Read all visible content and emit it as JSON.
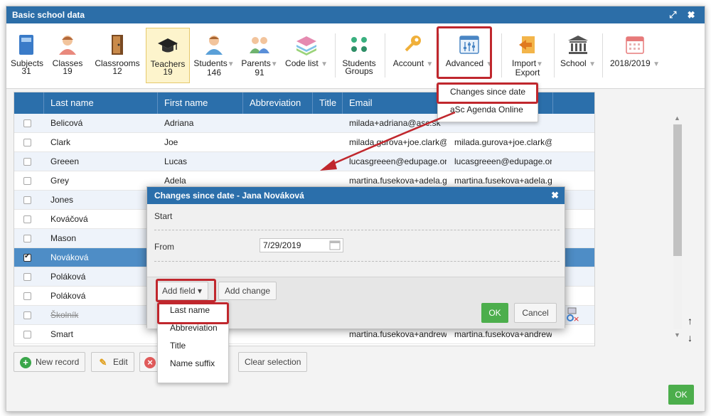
{
  "window": {
    "title": "Basic school data",
    "controls": "⤢ ✖"
  },
  "toolbar": {
    "subjects": {
      "label": "Subjects",
      "count": "31"
    },
    "classes": {
      "label": "Classes",
      "count": "19"
    },
    "classrooms": {
      "label": "Classrooms",
      "count": "12"
    },
    "teachers": {
      "label": "Teachers",
      "count": "19"
    },
    "students": {
      "label": "Students",
      "count": "146"
    },
    "parents": {
      "label": "Parents",
      "count": "91"
    },
    "codelist": {
      "label": "Code list"
    },
    "students_groups": {
      "label1": "Students",
      "label2": "Groups"
    },
    "account": {
      "label": "Account"
    },
    "advanced": {
      "label": "Advanced"
    },
    "import_export": {
      "label1": "Import",
      "label2": "Export"
    },
    "school": {
      "label": "School"
    },
    "year": {
      "label": "2018/2019"
    },
    "caret": "▼"
  },
  "advanced_menu": {
    "items": [
      "Changes since date",
      "aSc Agenda Online"
    ]
  },
  "grid": {
    "columns": [
      "Last name",
      "First name",
      "Abbreviation",
      "Title",
      "Email"
    ],
    "rows": [
      {
        "last": "Belicová",
        "first": "Adriana",
        "email": "milada+adriana@asc.sk",
        "email2": ""
      },
      {
        "last": "Clark",
        "first": "Joe",
        "email": "milada.gurova+joe.clark@",
        "email2": "milada.gurova+joe.clark@"
      },
      {
        "last": "Greeen",
        "first": "Lucas",
        "email": "lucasgreeen@edupage.org",
        "email2": "lucasgreeen@edupage.org"
      },
      {
        "last": "Grey",
        "first": "Adela",
        "email": "martina.fusekova+adela.gr",
        "email2": "martina.fusekova+adela.gr"
      },
      {
        "last": "Jones",
        "first": "",
        "email": "",
        "email2": ""
      },
      {
        "last": "Kováčová",
        "first": "",
        "email": "",
        "email2": ""
      },
      {
        "last": "Mason",
        "first": "",
        "email": "",
        "email2": ""
      },
      {
        "last": "Nováková",
        "first": "",
        "email": "",
        "email2": ""
      },
      {
        "last": "Poláková",
        "first": "",
        "email": "",
        "email2": ""
      },
      {
        "last": "Poláková",
        "first": "",
        "email": "",
        "email2": ""
      },
      {
        "last": "Školník",
        "first": "",
        "email": "",
        "email2": ""
      },
      {
        "last": "Smart",
        "first": "",
        "email": "martina.fusekova+andrews",
        "email2": "martina.fusekova+andrews"
      }
    ]
  },
  "bottom": {
    "new_record": "New record",
    "edit": "Edit",
    "clear_selection": "Clear selection",
    "ok": "OK"
  },
  "dialog": {
    "title": "Changes since date - Jana Nováková",
    "start_label": "Start",
    "from_label": "From",
    "from_value": "7/29/2019",
    "add_field": "Add field ▾",
    "add_change": "Add change",
    "ok": "OK",
    "cancel": "Cancel"
  },
  "addfield_menu": {
    "items": [
      "Last name",
      "Abbreviation",
      "Title",
      "Name suffix"
    ]
  },
  "side_arrows": {
    "up": "↑",
    "down": "↓"
  }
}
